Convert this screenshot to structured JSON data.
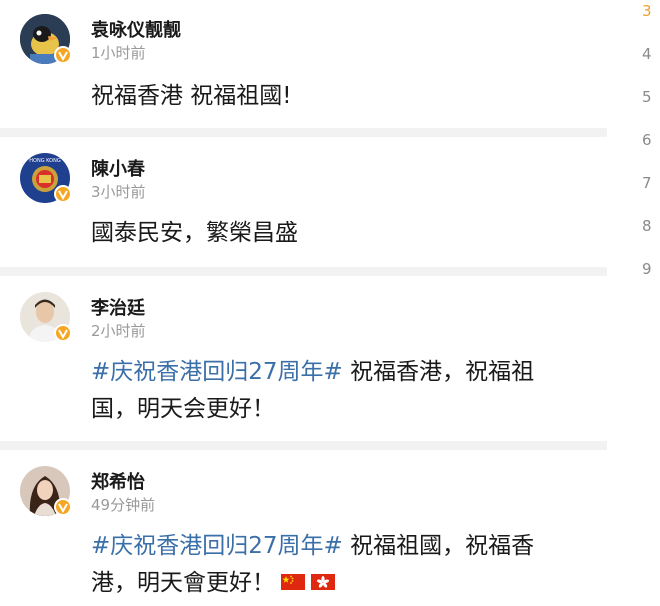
{
  "comments": [
    {
      "name": "袁咏仪靓靓",
      "time": "1小时前",
      "text": "祝福香港 祝福祖國!"
    },
    {
      "name": "陳小春",
      "time": "3小时前",
      "text": "國泰民安，繁榮昌盛"
    },
    {
      "name": "李治廷",
      "time": "2小时前",
      "hashtag": "#庆祝香港回归27周年#",
      "line1_rest": " 祝福香港，祝福祖",
      "line2": "国，明天会更好！"
    },
    {
      "name": "郑希怡",
      "time": "49分钟前",
      "hashtag": "#庆祝香港回归27周年#",
      "line1_rest": " 祝福祖國，祝福香",
      "line2": "港，明天會更好！"
    }
  ],
  "pagination": {
    "pages": [
      "3",
      "4",
      "5",
      "6",
      "7",
      "8",
      "9"
    ],
    "active": "3"
  },
  "icons": {
    "verified": "verified-badge-icon",
    "flags": [
      "china-flag-icon",
      "hong-kong-flag-icon"
    ]
  },
  "colors": {
    "hashtag": "#3b6fa8",
    "verified": "#f5a623",
    "active_page": "#f0a030"
  }
}
